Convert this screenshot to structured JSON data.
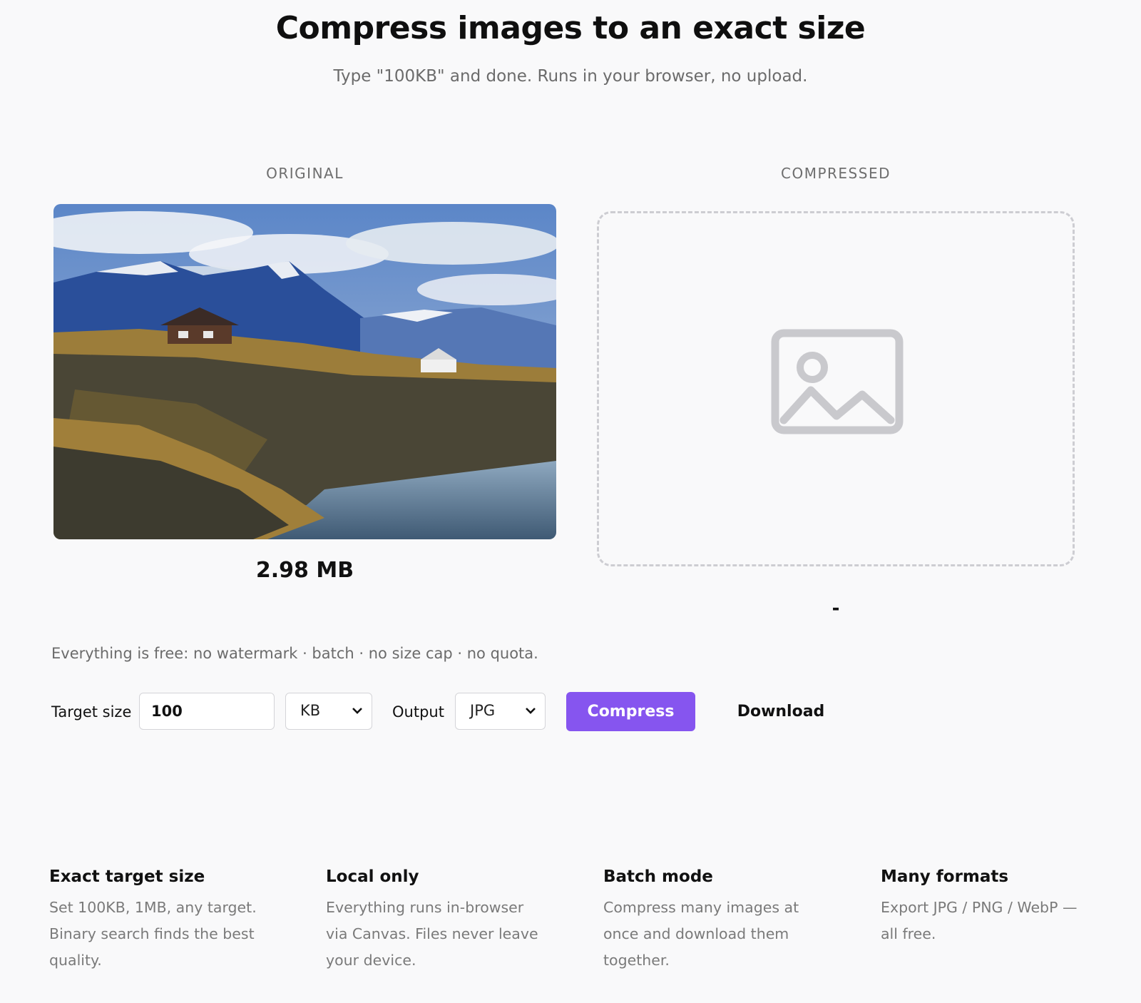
{
  "header": {
    "title": "Compress images to an exact size",
    "subtitle": "Type \"100KB\" and done. Runs in your browser, no upload."
  },
  "original": {
    "label": "ORIGINAL",
    "size": "2.98 MB"
  },
  "compressed": {
    "label": "COMPRESSED",
    "size": "-",
    "placeholder_icon": "image-placeholder-icon"
  },
  "free_note": "Everything is free: no watermark · batch · no size cap · no quota.",
  "controls": {
    "target_label": "Target size",
    "target_value": "100",
    "unit_selected": "KB",
    "output_label": "Output",
    "format_selected": "JPG",
    "compress_label": "Compress",
    "download_label": "Download"
  },
  "colors": {
    "accent": "#8655ef",
    "background": "#f9f9fa"
  },
  "features": [
    {
      "title": "Exact target size",
      "desc_lines": [
        "Set 100KB, 1MB, any target.",
        "Binary search finds the best",
        "quality."
      ]
    },
    {
      "title": "Local only",
      "desc_lines": [
        "Everything runs in-browser",
        "via Canvas. Files never leave",
        "your device."
      ]
    },
    {
      "title": "Batch mode",
      "desc_lines": [
        "Compress many images at",
        "once and download them",
        "together."
      ]
    },
    {
      "title": "Many formats",
      "desc_lines": [
        "Export JPG / PNG / WebP —",
        "all free."
      ]
    }
  ]
}
